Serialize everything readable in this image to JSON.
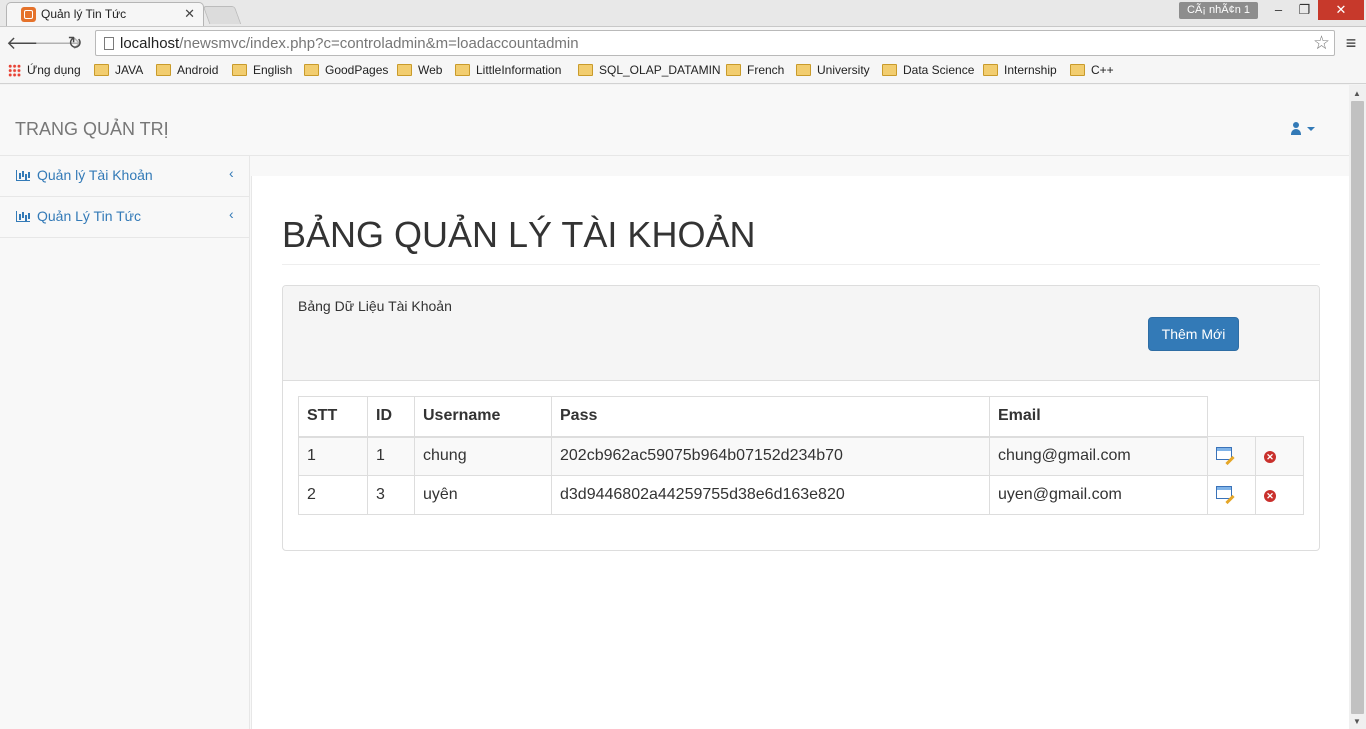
{
  "browser": {
    "tab_title": "Quản lý Tin Tức",
    "profile_label": "CÃ¡ nhÃ¢n 1",
    "url_host": "localhost",
    "url_path": "/newsmvc/index.php?c=controladmin&m=loadaccountadmin",
    "bookmarks": [
      {
        "label": "Ứng dụng",
        "icon": "apps-icon"
      },
      {
        "label": "JAVA",
        "icon": "folder-icon"
      },
      {
        "label": "Android",
        "icon": "folder-icon"
      },
      {
        "label": "English",
        "icon": "folder-icon"
      },
      {
        "label": "GoodPages",
        "icon": "folder-icon"
      },
      {
        "label": "Web",
        "icon": "folder-icon"
      },
      {
        "label": "LittleInformation",
        "icon": "folder-icon"
      },
      {
        "label": "SQL_OLAP_DATAMIN",
        "icon": "folder-icon"
      },
      {
        "label": "French",
        "icon": "folder-icon"
      },
      {
        "label": "University",
        "icon": "folder-icon"
      },
      {
        "label": "Data Science",
        "icon": "folder-icon"
      },
      {
        "label": "Internship",
        "icon": "folder-icon"
      },
      {
        "label": "C++",
        "icon": "folder-icon"
      }
    ]
  },
  "navbar": {
    "brand": "TRANG QUẢN TRỊ"
  },
  "sidebar": {
    "items": [
      {
        "label": "Quản lý Tài Khoản"
      },
      {
        "label": "Quản Lý Tin Tức"
      }
    ]
  },
  "main": {
    "title": "BẢNG QUẢN LÝ TÀI KHOẢN",
    "panel_title": "Bảng Dữ Liệu Tài Khoản",
    "add_button": "Thêm Mới",
    "columns": [
      "STT",
      "ID",
      "Username",
      "Pass",
      "Email"
    ],
    "rows": [
      {
        "stt": "1",
        "id": "1",
        "username": "chung",
        "pass": "202cb962ac59075b964b07152d234b70",
        "email": "chung@gmail.com"
      },
      {
        "stt": "2",
        "id": "3",
        "username": "uyên",
        "pass": "d3d9446802a44259755d38e6d163e820",
        "email": "uyen@gmail.com"
      }
    ]
  },
  "colors": {
    "primary": "#337ab7",
    "delete": "#c9302c",
    "close_button": "#c7392b"
  }
}
